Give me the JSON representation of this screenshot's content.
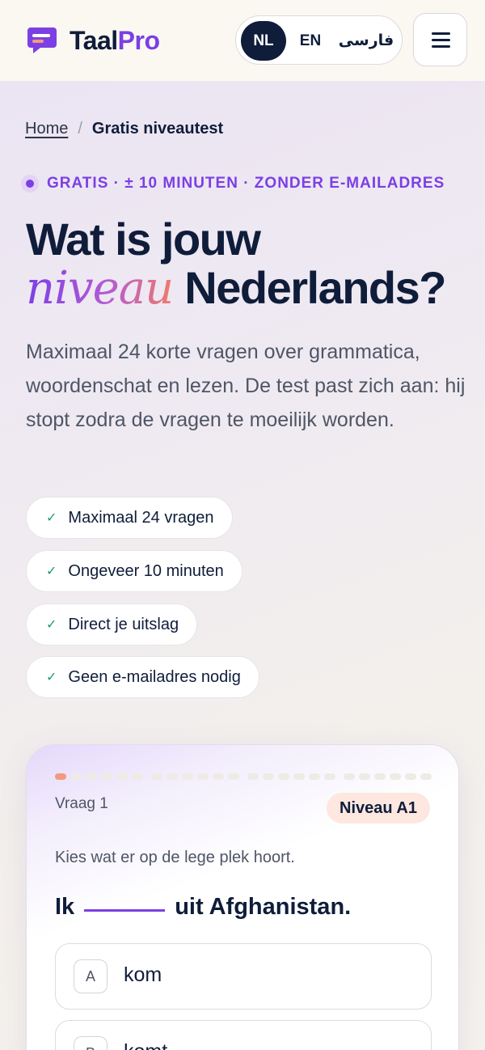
{
  "header": {
    "logo_taal": "Taal",
    "logo_pro": "Pro",
    "languages": {
      "nl": "NL",
      "en": "EN",
      "fa": "فارسی"
    },
    "active_language": "NL"
  },
  "breadcrumb": {
    "home": "Home",
    "separator": "/",
    "current": "Gratis niveautest"
  },
  "hero": {
    "eyebrow": "GRATIS · ± 10 MINUTEN · ZONDER E-MAILADRES",
    "title_line1": "Wat is jouw",
    "title_accent": "niveau",
    "title_line2_rest": " Nederlands?",
    "lead": "Maximaal 24 korte vragen over grammatica, woordenschat en lezen. De test past zich aan: hij stopt zodra de vragen te moeilijk worden."
  },
  "chips": [
    "Maximaal 24 vragen",
    "Ongeveer 10 minuten",
    "Direct je uitslag",
    "Geen e-mailadres nodig"
  ],
  "quiz": {
    "question_label": "Vraag 1",
    "level_badge": "Niveau A1",
    "progress": {
      "current": 1,
      "total": 24
    },
    "instruction": "Kies wat er op de lege plek hoort.",
    "sentence_before": "Ik",
    "sentence_after": "uit Afghanistan.",
    "options": [
      {
        "key": "A",
        "text": "kom"
      },
      {
        "key": "B",
        "text": "komt"
      }
    ]
  },
  "colors": {
    "brand_purple": "#7b3fe4",
    "navy": "#0f1d3a",
    "check_green": "#1c9b6b",
    "progress_active": "#f29a7e",
    "badge_bg": "#fde7df"
  }
}
